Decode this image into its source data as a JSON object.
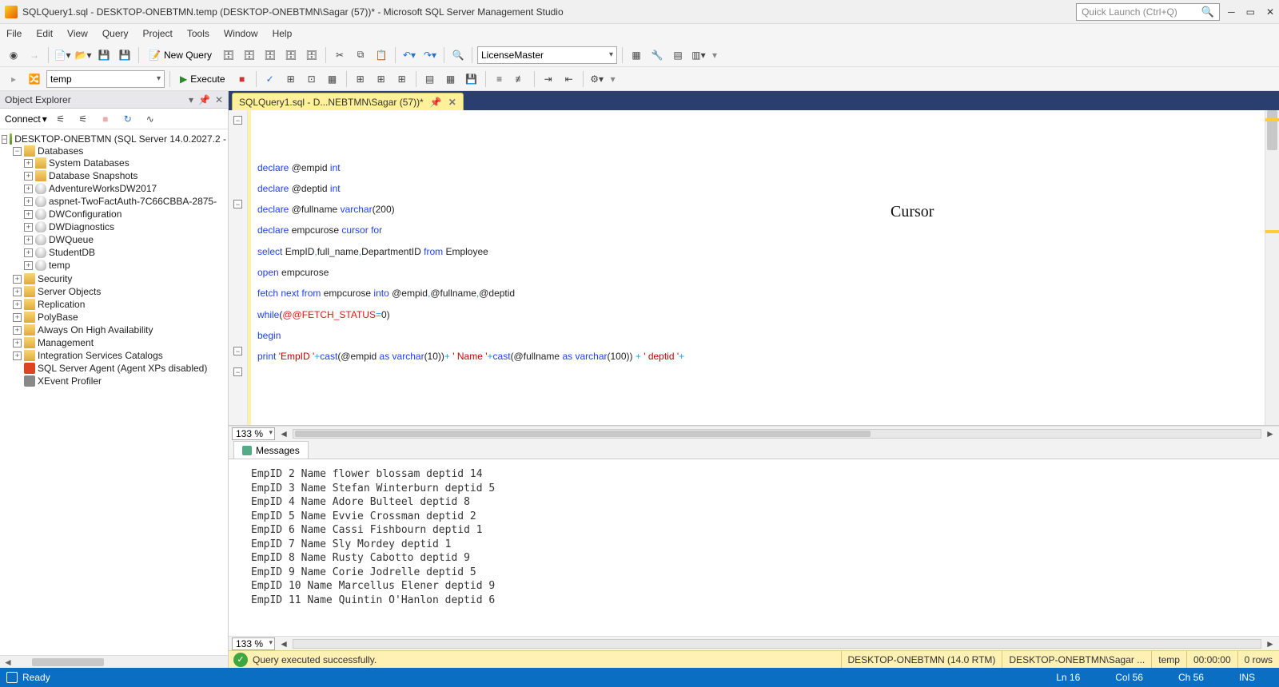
{
  "title": "SQLQuery1.sql - DESKTOP-ONEBTMN.temp (DESKTOP-ONEBTMN\\Sagar (57))* - Microsoft SQL Server Management Studio",
  "quicklaunch_placeholder": "Quick Launch (Ctrl+Q)",
  "menu": [
    "File",
    "Edit",
    "View",
    "Query",
    "Project",
    "Tools",
    "Window",
    "Help"
  ],
  "toolbar1": {
    "newquery": "New Query",
    "db_combo": "LicenseMaster"
  },
  "toolbar2": {
    "db_context": "temp",
    "execute": "Execute"
  },
  "objexp": {
    "title": "Object Explorer",
    "connect": "Connect",
    "server": "DESKTOP-ONEBTMN (SQL Server 14.0.2027.2 -",
    "nodes_root": "Databases",
    "db_children": [
      "System Databases",
      "Database Snapshots",
      "AdventureWorksDW2017",
      "aspnet-TwoFactAuth-7C66CBBA-2875-",
      "DWConfiguration",
      "DWDiagnostics",
      "DWQueue",
      "StudentDB",
      "temp"
    ],
    "server_children": [
      "Security",
      "Server Objects",
      "Replication",
      "PolyBase",
      "Always On High Availability",
      "Management",
      "Integration Services Catalogs",
      "SQL Server Agent (Agent XPs disabled)",
      "XEvent Profiler"
    ]
  },
  "tab": "SQLQuery1.sql - D...NEBTMN\\Sagar (57))*",
  "code": {
    "annotation": "Cursor",
    "lines": [
      [
        [
          "kw",
          "declare"
        ],
        [
          "",
          " @empid "
        ],
        [
          "ty",
          "int"
        ]
      ],
      [
        [
          "kw",
          "declare"
        ],
        [
          "",
          " @deptid "
        ],
        [
          "ty",
          "int"
        ]
      ],
      [
        [
          "kw",
          "declare"
        ],
        [
          "",
          " @fullname "
        ],
        [
          "ty",
          "varchar"
        ],
        [
          "",
          "(200)"
        ]
      ],
      [
        [
          "",
          ""
        ]
      ],
      [
        [
          "kw",
          "declare"
        ],
        [
          "",
          " empcurose "
        ],
        [
          "kw",
          "cursor"
        ],
        [
          "",
          " "
        ],
        [
          "kw",
          "for"
        ]
      ],
      [
        [
          "kw",
          "select"
        ],
        [
          "",
          " EmpID"
        ],
        [
          "lightblue",
          ","
        ],
        [
          "",
          "full_name"
        ],
        [
          "lightblue",
          ","
        ],
        [
          "",
          "DepartmentID "
        ],
        [
          "kw",
          "from"
        ],
        [
          "",
          " Employee"
        ]
      ],
      [
        [
          "",
          ""
        ]
      ],
      [
        [
          "kw",
          "open"
        ],
        [
          "",
          " empcurose"
        ]
      ],
      [
        [
          "",
          ""
        ]
      ],
      [
        [
          "kw",
          "fetch"
        ],
        [
          "",
          " "
        ],
        [
          "kw",
          "next"
        ],
        [
          "",
          " "
        ],
        [
          "kw",
          "from"
        ],
        [
          "",
          " empcurose "
        ],
        [
          "kw",
          "into"
        ],
        [
          "",
          " @empid"
        ],
        [
          "lightblue",
          ","
        ],
        [
          "",
          "@fullname"
        ],
        [
          "lightblue",
          ","
        ],
        [
          "",
          "@deptid"
        ]
      ],
      [
        [
          "",
          ""
        ]
      ],
      [
        [
          "kw",
          "while"
        ],
        [
          "",
          "("
        ],
        [
          "sysvar",
          "@@FETCH_STATUS"
        ],
        [
          "lightblue",
          "="
        ],
        [
          "",
          "0)"
        ]
      ],
      [
        [
          "kw",
          "begin"
        ]
      ],
      [
        [
          "",
          ""
        ]
      ],
      [
        [
          "kw",
          "print"
        ],
        [
          "",
          " "
        ],
        [
          "str",
          "'EmpID '"
        ],
        [
          "lightblue",
          "+"
        ],
        [
          "kw",
          "cast"
        ],
        [
          "",
          "(@empid "
        ],
        [
          "kw",
          "as"
        ],
        [
          "",
          " "
        ],
        [
          "ty",
          "varchar"
        ],
        [
          "",
          "(10))"
        ],
        [
          "lightblue",
          "+"
        ],
        [
          "",
          " "
        ],
        [
          "str",
          "' Name '"
        ],
        [
          "lightblue",
          "+"
        ],
        [
          "kw",
          "cast"
        ],
        [
          "",
          "(@fullname "
        ],
        [
          "kw",
          "as"
        ],
        [
          "",
          " "
        ],
        [
          "ty",
          "varchar"
        ],
        [
          "",
          "(100)) "
        ],
        [
          "lightblue",
          "+"
        ],
        [
          "",
          " "
        ],
        [
          "str",
          "' deptid '"
        ],
        [
          "lightblue",
          "+"
        ]
      ]
    ]
  },
  "zoom1": "133 %",
  "messages_tab": "Messages",
  "messages": [
    "EmpID 2 Name flower blossam deptid 14",
    "EmpID 3 Name Stefan Winterburn deptid 5",
    "EmpID 4 Name Adore Bulteel deptid 8",
    "EmpID 5 Name Evvie Crossman deptid 2",
    "EmpID 6 Name Cassi Fishbourn deptid 1",
    "EmpID 7 Name Sly Mordey deptid 1",
    "EmpID 8 Name Rusty Cabotto deptid 9",
    "EmpID 9 Name Corie Jodrelle deptid 5",
    "EmpID 10 Name Marcellus Elener deptid 9",
    "EmpID 11 Name Quintin O'Hanlon deptid 6"
  ],
  "zoom2": "133 %",
  "status": {
    "msg": "Query executed successfully.",
    "server": "DESKTOP-ONEBTMN (14.0 RTM)",
    "user": "DESKTOP-ONEBTMN\\Sagar ...",
    "db": "temp",
    "time": "00:00:00",
    "rows": "0 rows"
  },
  "bottom": {
    "ready": "Ready",
    "ln": "Ln 16",
    "col": "Col 56",
    "ch": "Ch 56",
    "ins": "INS"
  }
}
